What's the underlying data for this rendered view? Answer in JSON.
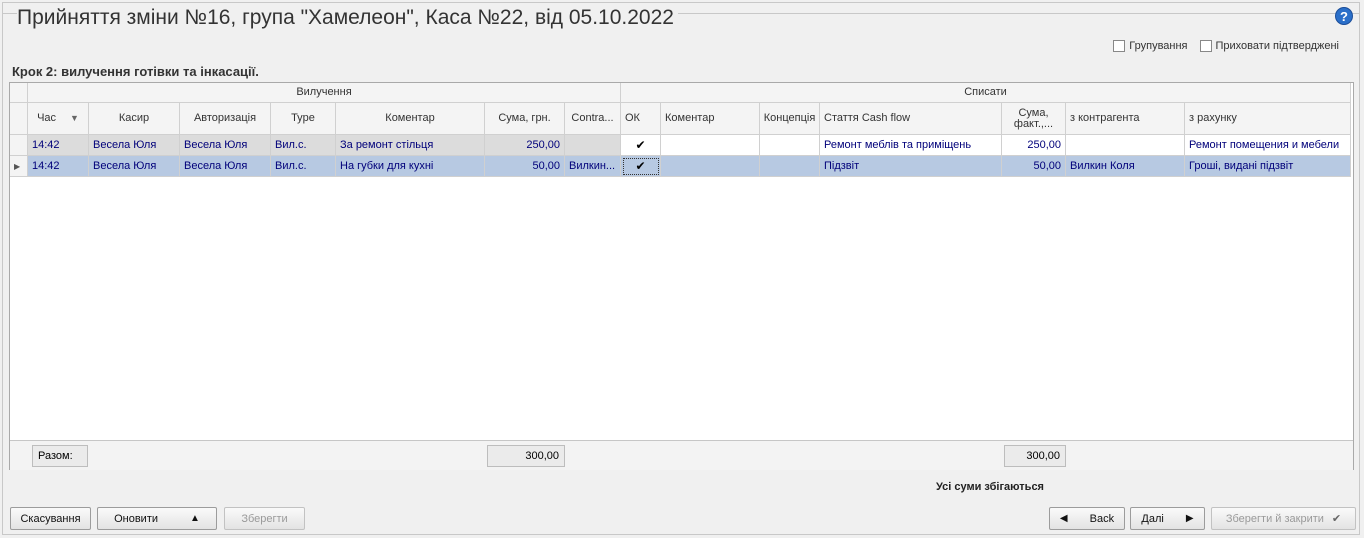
{
  "window": {
    "title": "Прийняття зміни №16, група \"Хамелеон\", Каса №22, від 05.10.2022",
    "help_label": "?"
  },
  "options": {
    "grouping_label": "Групування",
    "hide_confirmed_label": "Приховати підтверджені"
  },
  "step_title": "Крок 2: вилучення готівки та інкасації.",
  "table": {
    "group_headers": [
      "Вилучення",
      "Списати"
    ],
    "columns": [
      "Час",
      "Касир",
      "Авторизація",
      "Type",
      "Коментар",
      "Сума, грн.",
      "Contra...",
      "ОК",
      "Коментар",
      "Концепція",
      "Стаття Cash flow",
      "Сума, факт.,...",
      "з контрагента",
      "з рахунку"
    ],
    "rows": [
      [
        "14:42",
        "Весела Юля",
        "Весела Юля",
        "Вил.с.",
        "За ремонт стільця",
        "250,00",
        "",
        "✔",
        "",
        "",
        "Ремонт меблів та приміщень",
        "250,00",
        "",
        "Ремонт помещения и мебели"
      ],
      [
        "14:42",
        "Весела Юля",
        "Весела Юля",
        "Вил.с.",
        "На губки для кухні",
        "50,00",
        "Вилкин...",
        "✔",
        "",
        "",
        "Підзвіт",
        "50,00",
        "Вилкин Коля",
        "Гроші, видані підзвіт"
      ]
    ],
    "footer": {
      "label": "Разом:",
      "total_sum": "300,00",
      "total_fact": "300,00"
    }
  },
  "status_text": "Усі суми збігаються",
  "buttons": {
    "cancel": "Скасування",
    "refresh": "Оновити",
    "save": "Зберегти",
    "back": "Back",
    "next": "Далі",
    "save_close": "Зберегти й закрити"
  }
}
